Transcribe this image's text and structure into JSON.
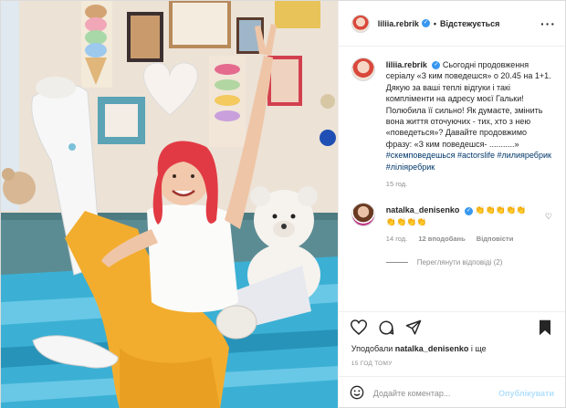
{
  "header": {
    "username": "liliia.rebrik",
    "follow_label": "Відстежується",
    "more_label": "···"
  },
  "caption": {
    "username": "liliia.rebrik",
    "text": "Сьогодні продовження серіалу «З ким поведешся» о 20.45 на 1+1. Дякую за ваші теплі відгуки і такі компліменти на адресу моєї Гальки! Полюбила її сильно! Як думаєте, змінить вона життя оточуючих - тих, хто з нею «поведеться»? Давайте продовжимо фразу: «З ким поведешся- ...........»",
    "hashtags": "#скемповедешься #actorslife #лилияребрик #ліліяребрик",
    "time": "15 год."
  },
  "comment": {
    "username": "natalka_denisenko",
    "text": "👏👏👏👏👏👏👏👏👏",
    "time": "14 год.",
    "likes": "12 вподобань",
    "reply": "Відповісти",
    "heart_icon": "♡",
    "view_replies": "Переглянути відповіді (2)"
  },
  "likes": {
    "prefix": "Уподобали",
    "user": "natalka_denisenko",
    "suffix": "і ще"
  },
  "timestamp": "15 ГОД ТОМУ",
  "add_comment": {
    "emoji_icon": "smile-icon",
    "placeholder": "Додайте коментар...",
    "publish_label": "Опублікувати"
  },
  "colors": {
    "link": "#00376b",
    "muted": "#8e8e8e",
    "verified": "#3897f0",
    "publish_disabled": "#b2dffc"
  }
}
